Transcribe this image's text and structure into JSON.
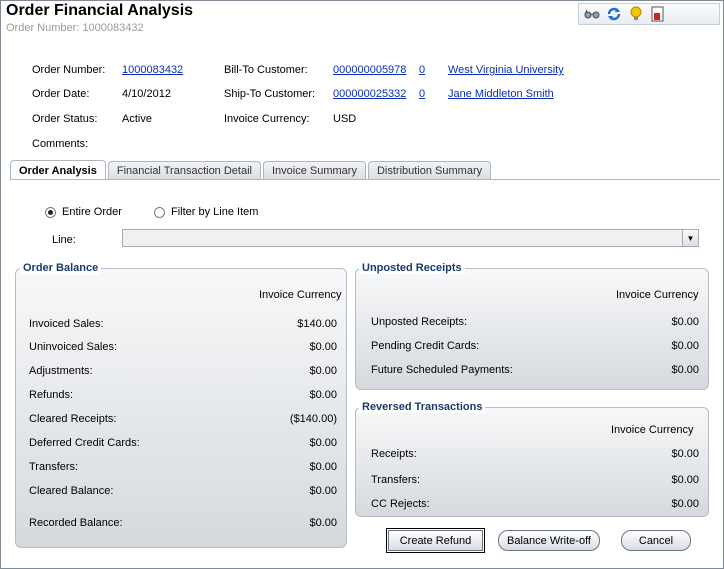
{
  "header": {
    "title": "Order Financial Analysis",
    "subtitle": "Order Number: 1000083432"
  },
  "toolbar": {
    "icons": [
      "glasses-icon",
      "refresh-icon",
      "lightbulb-icon",
      "report-icon"
    ]
  },
  "order": {
    "order_number_label": "Order Number:",
    "order_number": "1000083432",
    "order_date_label": "Order Date:",
    "order_date": "4/10/2012",
    "order_status_label": "Order Status:",
    "order_status": "Active",
    "comments_label": "Comments:",
    "bill_to_label": "Bill-To Customer:",
    "bill_to_id": "000000005978",
    "bill_to_zero": "0",
    "bill_to_name": "West Virginia University",
    "ship_to_label": "Ship-To Customer:",
    "ship_to_id": "000000025332",
    "ship_to_zero": "0",
    "ship_to_name": "Jane Middleton Smith",
    "currency_label": "Invoice Currency:",
    "currency": "USD"
  },
  "tabs": [
    "Order Analysis",
    "Financial Transaction Detail",
    "Invoice Summary",
    "Distribution Summary"
  ],
  "filter": {
    "entire_order": "Entire Order",
    "by_line_item": "Filter by Line Item",
    "line_label": "Line:"
  },
  "order_balance": {
    "title": "Order Balance",
    "column": "Invoice Currency",
    "rows": [
      {
        "label": "Invoiced Sales:",
        "value": "$140.00"
      },
      {
        "label": "Uninvoiced Sales:",
        "value": "$0.00"
      },
      {
        "label": "Adjustments:",
        "value": "$0.00"
      },
      {
        "label": "Refunds:",
        "value": "$0.00"
      },
      {
        "label": "Cleared Receipts:",
        "value": "($140.00)"
      },
      {
        "label": "Deferred Credit Cards:",
        "value": "$0.00"
      },
      {
        "label": "Transfers:",
        "value": "$0.00"
      },
      {
        "label": "Cleared Balance:",
        "value": "$0.00"
      },
      {
        "label": "Recorded Balance:",
        "value": "$0.00"
      }
    ]
  },
  "unposted": {
    "title": "Unposted Receipts",
    "column": "Invoice Currency",
    "rows": [
      {
        "label": "Unposted Receipts:",
        "value": "$0.00"
      },
      {
        "label": "Pending Credit Cards:",
        "value": "$0.00"
      },
      {
        "label": "Future Scheduled Payments:",
        "value": "$0.00"
      }
    ]
  },
  "reversed": {
    "title": "Reversed Transactions",
    "column": "Invoice Currency",
    "rows": [
      {
        "label": "Receipts:",
        "value": "$0.00"
      },
      {
        "label": "Transfers:",
        "value": "$0.00"
      },
      {
        "label": "CC Rejects:",
        "value": "$0.00"
      }
    ]
  },
  "buttons": {
    "create_refund": "Create Refund",
    "balance_writeoff": "Balance Write-off",
    "cancel": "Cancel"
  }
}
